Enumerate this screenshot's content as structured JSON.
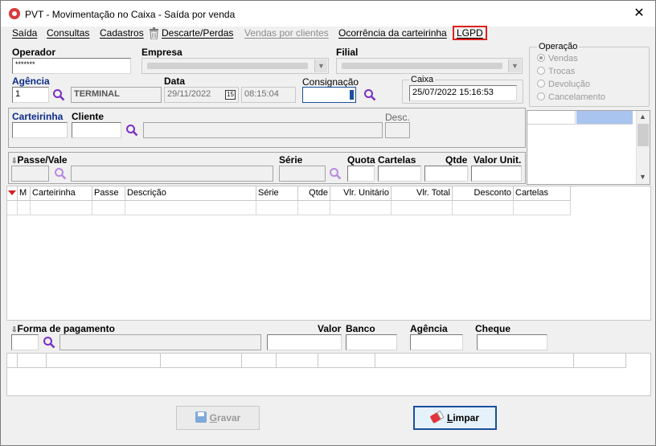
{
  "window": {
    "title": "PVT - Movimentação no Caixa - Saída por venda",
    "close": "✕"
  },
  "menu": {
    "saida": "Saída",
    "consultas": "Consultas",
    "cadastros": "Cadastros",
    "descarte": "Descarte/Perdas",
    "vendas_clientes": "Vendas por clientes",
    "ocorrencia": "Ocorrência da carteirinha",
    "lgpd": "LGPD"
  },
  "header": {
    "operador_label": "Operador",
    "operador_value": "*******",
    "empresa_label": "Empresa",
    "filial_label": "Filial",
    "agencia_label": "Agência",
    "agencia_value": "1",
    "terminal_value": "TERMINAL",
    "data_label": "Data",
    "data_value": "29/11/2022",
    "data_icon": "15",
    "hora_value": "08:15:04",
    "consignacao_label": "Consignação",
    "caixa_label": "Caixa",
    "caixa_value": "25/07/2022 15:16:53"
  },
  "operacao": {
    "label": "Operação",
    "options": [
      "Vendas",
      "Trocas",
      "Devolução",
      "Cancelamento"
    ],
    "selected": "Vendas"
  },
  "cliente_section": {
    "carteirinha_label": "Carteirinha",
    "cliente_label": "Cliente",
    "desc_label": "Desc."
  },
  "passe_section": {
    "passe_label": "Passe/Vale",
    "serie_label": "Série",
    "quota_label": "Quota",
    "cartelas_label": "Cartelas",
    "qtde_label": "Qtde",
    "valor_unit_label": "Valor Unit."
  },
  "items_grid": {
    "columns": [
      "",
      "M",
      "Carteirinha",
      "Passe",
      "Descrição",
      "Série",
      "Qtde",
      "Vlr. Unitário",
      "Vlr. Total",
      "Desconto",
      "Cartelas"
    ]
  },
  "pagamento": {
    "forma_label": "Forma de pagamento",
    "valor_label": "Valor",
    "banco_label": "Banco",
    "agencia_label": "Agência",
    "cheque_label": "Cheque"
  },
  "buttons": {
    "gravar_prefix": "G",
    "gravar_rest": "ravar",
    "limpar_prefix": "L",
    "limpar_rest": "impar"
  },
  "colors": {
    "lgpd_border": "#e02020",
    "search_icon": "#7b2fc4",
    "grid_highlight": "#a9c4ef",
    "sort_arrow": "#d42020"
  }
}
